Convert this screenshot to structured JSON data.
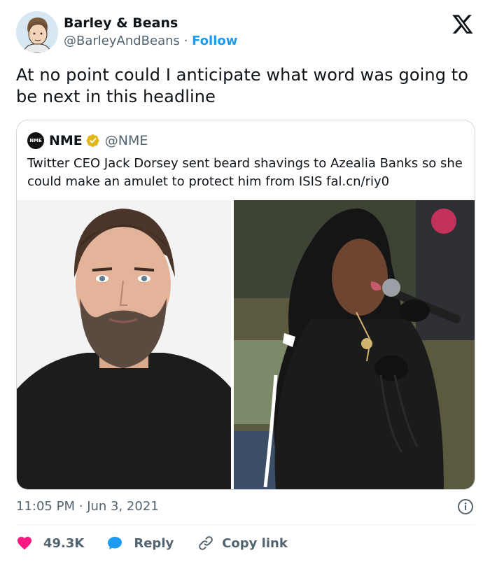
{
  "author": {
    "display_name": "Barley & Beans",
    "handle": "@BarleyAndBeans",
    "separator": "·",
    "follow_label": "Follow"
  },
  "tweet": {
    "text": "At no point could I anticipate what word was going to be next in this headline"
  },
  "quoted": {
    "logo_text": "NME",
    "name": "NME",
    "handle": "@NME",
    "text": "Twitter CEO Jack Dorsey sent beard shavings to Azealia Banks so she could make an amulet to protect him from ISIS fal.cn/riy0"
  },
  "meta": {
    "time": "11:05 PM",
    "separator": "·",
    "date": "Jun 3, 2021"
  },
  "actions": {
    "likes": "49.3K",
    "reply_label": "Reply",
    "copy_link_label": "Copy link"
  },
  "colors": {
    "accent": "#1d9bf0",
    "like": "#f91880",
    "verified": "#e2b719",
    "muted_text": "#536471"
  },
  "icons": [
    "x-logo-icon",
    "verified-badge-icon",
    "info-icon",
    "heart-icon",
    "reply-bubble-icon",
    "link-icon"
  ]
}
